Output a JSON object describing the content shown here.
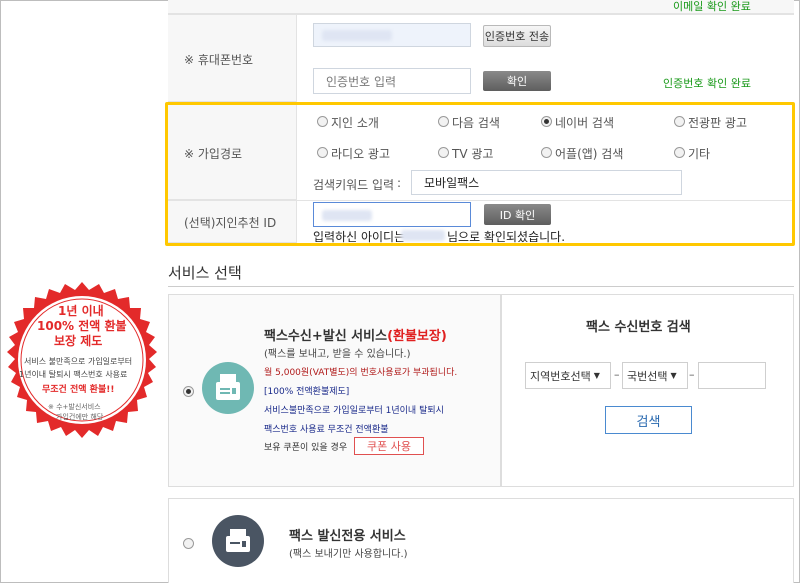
{
  "form": {
    "email_status": "이메일 확인 완료",
    "phone": {
      "label": "※ 휴대폰번호",
      "send_button": "인증번호 전송",
      "code_placeholder": "인증번호 입력",
      "confirm_button": "확인",
      "status": "인증번호 확인 완료"
    },
    "join_path": {
      "label": "※ 가입경로",
      "options": [
        "지인 소개",
        "다음 검색",
        "네이버 검색",
        "전광판 광고",
        "라디오 광고",
        "TV 광고",
        "어플(앱) 검색",
        "기타"
      ],
      "selected": "네이버 검색",
      "keyword_label": "검색키워드 입력",
      "keyword_separator": ":",
      "keyword_value": "모바일팩스"
    },
    "referrer": {
      "label": "(선택)지인추천 ID",
      "confirm_button": "ID 확인",
      "message_prefix": "입력하신 아이디는",
      "message_suffix": "님으로 확인되셨습니다."
    }
  },
  "services": {
    "section_title": "서비스 선택",
    "badge": {
      "line1": "1년 이내",
      "line2": "100% 전액 환불",
      "line3": "보장 제도",
      "desc1": "서비스 불만족으로 가입일로부터",
      "desc2": "1년이내 탈퇴시 팩스번호 사용료",
      "desc3": "무조건 전액 환불!!",
      "note1": "※ 수+발신서비스",
      "note2": "가입건에만 해당"
    },
    "send_receive": {
      "title": "팩스수신+발신 서비스",
      "title_tag": "(환불보장)",
      "subtitle": "(팩스를 보내고, 받을 수 있습니다.)",
      "fee": "월 5,000원(VAT별도)의 번호사용료가 부과됩니다.",
      "refund": "[100% 전액환불제도]",
      "refund_desc1": "서비스불만족으로 가입일로부터 1년이내 탈퇴시",
      "refund_desc2": "팩스번호 사용료 무조건 전액환불",
      "coupon_label": "보유 쿠폰이 있을 경우",
      "coupon_button": "쿠폰 사용"
    },
    "number_search": {
      "title": "팩스 수신번호 검색",
      "area_select": "지역번호선택",
      "exchange_select": "국번선택",
      "dash": "–",
      "search_button": "검색"
    },
    "send_only": {
      "title": "팩스 발신전용 서비스",
      "subtitle": "(팩스 보내기만 사용합니다.)"
    }
  },
  "colors": {
    "highlight": "#ffc800",
    "badge_red": "#e32a2a",
    "icon_teal": "#6fb8b3",
    "icon_dark": "#4a5563",
    "status_green": "#1a9a1a"
  }
}
